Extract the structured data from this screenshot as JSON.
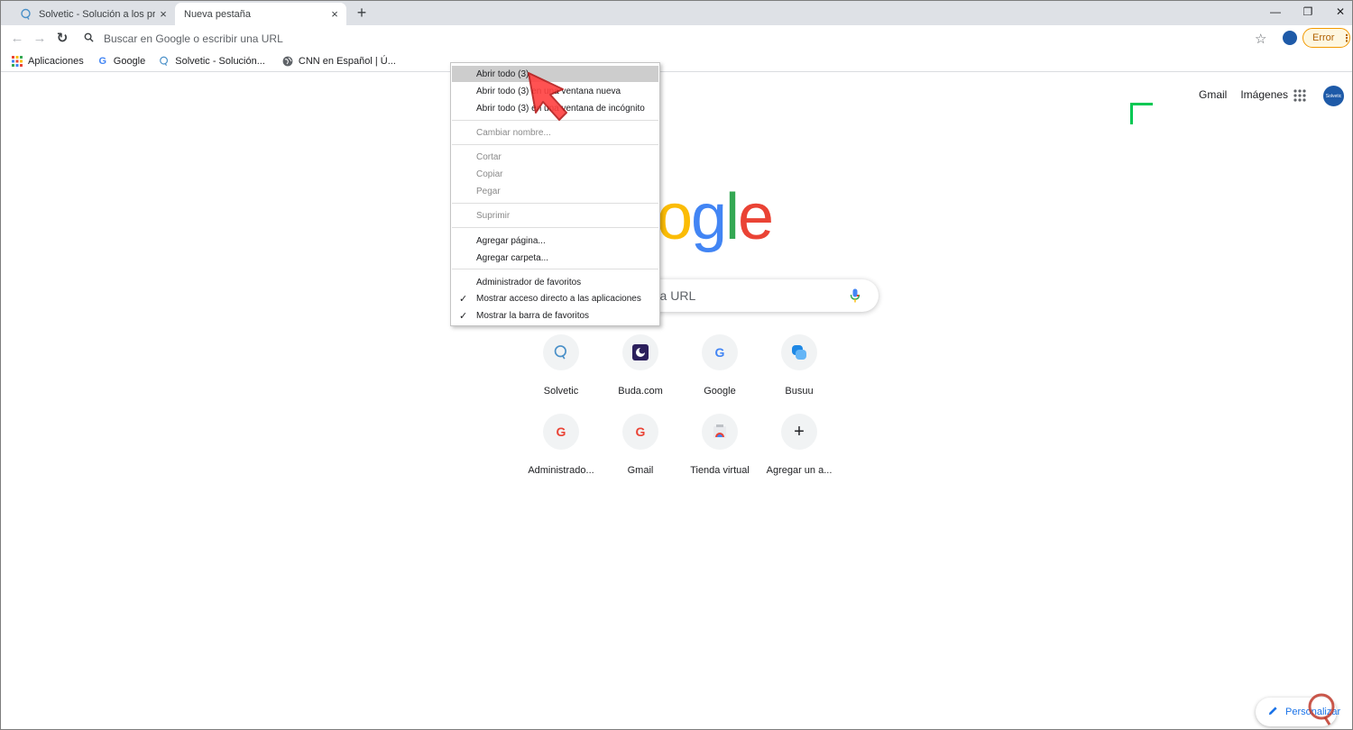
{
  "tabs": [
    {
      "title": "Solvetic - Solución a los problemas",
      "favicon": "solvetic-icon",
      "close": "×"
    },
    {
      "title": "Nueva pestaña",
      "favicon": "",
      "close": "×"
    }
  ],
  "new_tab_label": "+",
  "window_controls": {
    "minimize": "—",
    "restore": "❐",
    "close": "✕"
  },
  "toolbar": {
    "back": "←",
    "forward": "→",
    "reload": "↻",
    "omnibox_placeholder": "Buscar en Google o escribir una URL",
    "star": "☆",
    "error_label": "Error",
    "error_menu": "⋮"
  },
  "bookmarks": [
    {
      "label": "Aplicaciones",
      "icon": "apps-grid-icon"
    },
    {
      "label": "Google",
      "icon": "google-g-icon"
    },
    {
      "label": "Solvetic - Solución...",
      "icon": "solvetic-icon"
    },
    {
      "label": "CNN en Español | Ú...",
      "icon": "globe-icon"
    }
  ],
  "page": {
    "top_links": {
      "gmail": "Gmail",
      "images": "Imágenes"
    },
    "avatar_text": "Solvetic",
    "search_placeholder": "Busca en Google o escribir una URL",
    "shortcuts": [
      {
        "label": "Solvetic",
        "icon": "solvetic-icon"
      },
      {
        "label": "Buda.com",
        "icon": "buda-icon"
      },
      {
        "label": "Google",
        "icon": "google-g-icon"
      },
      {
        "label": "Busuu",
        "icon": "busuu-icon"
      },
      {
        "label": "Administrado...",
        "icon": "google-g-icon"
      },
      {
        "label": "Gmail",
        "icon": "google-g-icon"
      },
      {
        "label": "Tienda virtual",
        "icon": "chrome-store-icon"
      },
      {
        "label": "Agregar un a...",
        "icon": "plus-icon"
      }
    ],
    "customize_label": "Personalizar"
  },
  "context_menu": {
    "groups": [
      [
        {
          "label": "Abrir todo (3)",
          "enabled": true,
          "highlighted": true
        },
        {
          "label": "Abrir todo (3) en una ventana nueva",
          "enabled": true
        },
        {
          "label": "Abrir todo (3) en una ventana de incógnito",
          "enabled": true
        }
      ],
      [
        {
          "label": "Cambiar nombre...",
          "enabled": false
        }
      ],
      [
        {
          "label": "Cortar",
          "enabled": false
        },
        {
          "label": "Copiar",
          "enabled": false
        },
        {
          "label": "Pegar",
          "enabled": false
        }
      ],
      [
        {
          "label": "Suprimir",
          "enabled": false
        }
      ],
      [
        {
          "label": "Agregar página...",
          "enabled": true
        },
        {
          "label": "Agregar carpeta...",
          "enabled": true
        }
      ],
      [
        {
          "label": "Administrador de favoritos",
          "enabled": true
        },
        {
          "label": "Mostrar acceso directo a las aplicaciones",
          "enabled": true,
          "checked": true
        },
        {
          "label": "Mostrar la barra de favoritos",
          "enabled": true,
          "checked": true
        }
      ]
    ],
    "check_glyph": "✓"
  },
  "colors": {
    "accent_blue": "#4285f4",
    "accent_red": "#ea4335",
    "accent_yellow": "#fbbc05",
    "accent_green": "#34a853",
    "error_orange": "#f29900",
    "highlight_gray": "#cdcdcd",
    "cursor_red": "#ff4040"
  }
}
